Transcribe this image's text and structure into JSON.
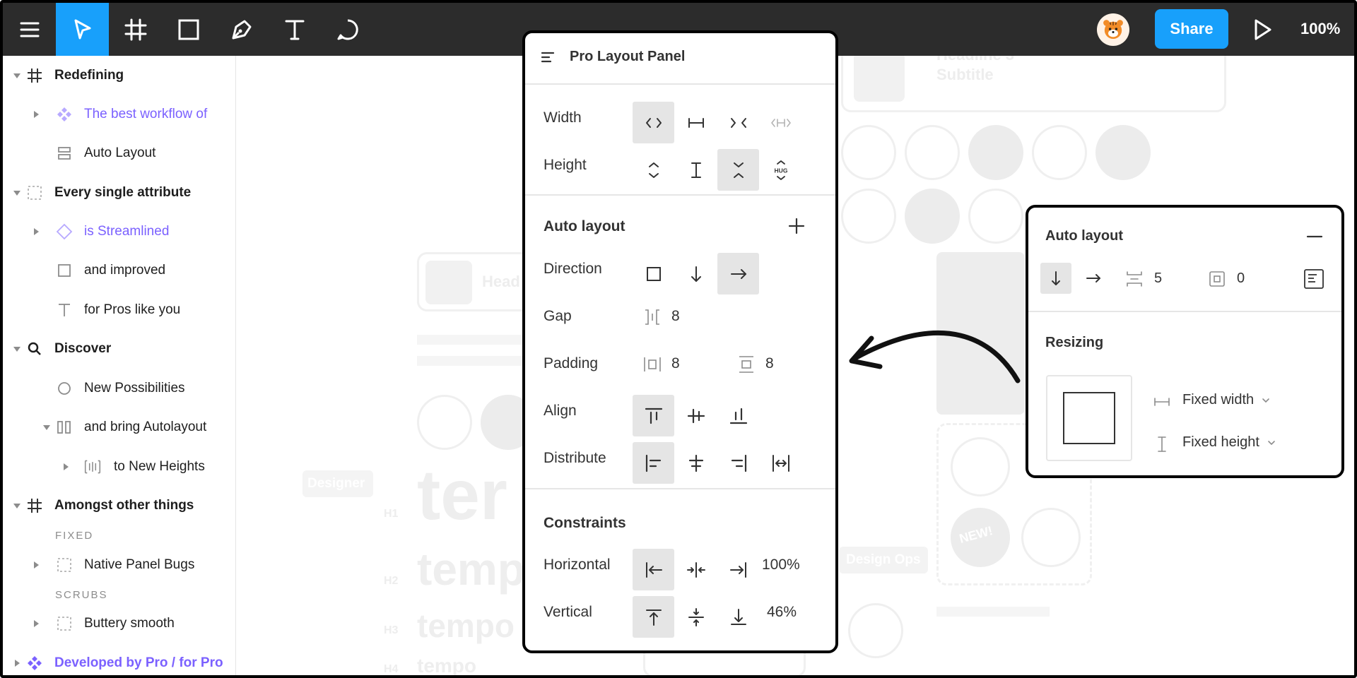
{
  "toolbar": {
    "tools": [
      {
        "name": "menu-icon"
      },
      {
        "name": "cursor-icon"
      },
      {
        "name": "frame-icon"
      },
      {
        "name": "rectangle-icon"
      },
      {
        "name": "pen-icon"
      },
      {
        "name": "text-icon"
      },
      {
        "name": "comment-icon"
      }
    ],
    "share_label": "Share",
    "zoom": "100%"
  },
  "layers": {
    "items": [
      {
        "label": "Redefining"
      },
      {
        "label": "The best workflow of"
      },
      {
        "label": "Auto Layout"
      },
      {
        "label": "Every single attribute"
      },
      {
        "label": "is Streamlined"
      },
      {
        "label": "and improved"
      },
      {
        "label": "for Pros like you"
      },
      {
        "label": "Discover"
      },
      {
        "label": "New Possibilities"
      },
      {
        "label": "and bring Autolayout"
      },
      {
        "label": "to New Heights"
      },
      {
        "label": "Amongst other things"
      },
      {
        "label": "Native Panel Bugs"
      },
      {
        "label": "Buttery smooth"
      },
      {
        "label": "Developed by Pro / for Pro"
      }
    ],
    "sections": [
      "FIXED",
      "SCRUBS"
    ]
  },
  "canvas": {
    "ghost_texts": [
      "Headline 3",
      "Subtitle",
      "Head",
      "ter",
      "temp",
      "tempo",
      "tempo",
      "H1",
      "H2",
      "H3",
      "H4",
      "Designer",
      "Design Ops",
      "NEW!"
    ]
  },
  "pro_panel": {
    "title": "Pro Layout Panel",
    "width_label": "Width",
    "height_label": "Height",
    "auto_layout_title": "Auto layout",
    "direction_label": "Direction",
    "gap_label": "Gap",
    "gap_value": "8",
    "padding_label": "Padding",
    "padding_h_value": "8",
    "padding_v_value": "8",
    "align_label": "Align",
    "distribute_label": "Distribute",
    "constraints_title": "Constraints",
    "horizontal_label": "Horizontal",
    "horizontal_value": "100%",
    "vertical_label": "Vertical",
    "vertical_value": "46%"
  },
  "auto_panel": {
    "title": "Auto layout",
    "spacing_value": "5",
    "padding_value": "0",
    "resizing_title": "Resizing",
    "width_option": "Fixed width",
    "height_option": "Fixed height"
  },
  "colors": {
    "toolbar": "#2c2c2c",
    "accent": "#18a0fb",
    "component_purple": "#7b61ff",
    "selected_option": "#e5e5e5"
  }
}
